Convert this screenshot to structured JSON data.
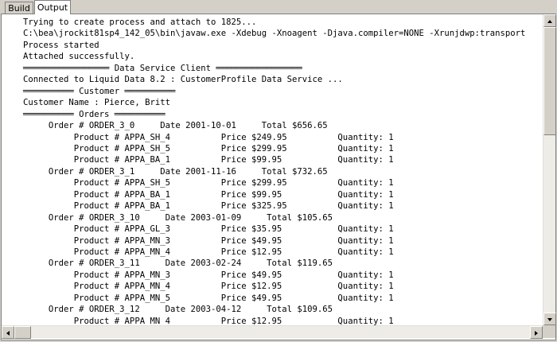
{
  "tabs": {
    "build": "Build",
    "output": "Output"
  },
  "output_lines": [
    "Trying to create process and attach to 1825...",
    "C:\\bea\\jrockit81sp4_142_05\\bin\\javaw.exe -Xdebug -Xnoagent -Djava.compiler=NONE -Xrunjdwp:transport",
    "Process started",
    "Attached successfully.",
    "═════════════════ Data Service Client ═════════════════",
    "Connected to Liquid Data 8.2 : CustomerProfile Data Service ...",
    "══════════ Customer ══════════",
    "Customer Name : Pierce, Britt",
    "══════════ Orders ══════════",
    "     Order # ORDER_3_0     Date 2001-10-01     Total $656.65",
    "          Product # APPA_SH_4          Price $249.95          Quantity: 1",
    "          Product # APPA_SH_5          Price $299.95          Quantity: 1",
    "          Product # APPA_BA_1          Price $99.95           Quantity: 1",
    "     Order # ORDER_3_1     Date 2001-11-16     Total $732.65",
    "          Product # APPA_SH_5          Price $299.95          Quantity: 1",
    "          Product # APPA_BA_1          Price $99.95           Quantity: 1",
    "          Product # APPA_BA_1          Price $325.95          Quantity: 1",
    "     Order # ORDER_3_10     Date 2003-01-09     Total $105.65",
    "          Product # APPA_GL_3          Price $35.95           Quantity: 1",
    "          Product # APPA_MN_3          Price $49.95           Quantity: 1",
    "          Product # APPA_MN_4          Price $12.95           Quantity: 1",
    "     Order # ORDER_3_11     Date 2003-02-24     Total $119.65",
    "          Product # APPA_MN_3          Price $49.95           Quantity: 1",
    "          Product # APPA_MN_4          Price $12.95           Quantity: 1",
    "          Product # APPA_MN_5          Price $49.95           Quantity: 1",
    "     Order # ORDER_3_12     Date 2003-04-12     Total $109.65",
    "          Product # APPA_MN_4          Price $12.95           Quantity: 1"
  ],
  "icons": {
    "scroll_up": "triangle-up-icon",
    "scroll_down": "triangle-down-icon",
    "scroll_left": "triangle-left-icon",
    "scroll_right": "triangle-right-icon"
  }
}
